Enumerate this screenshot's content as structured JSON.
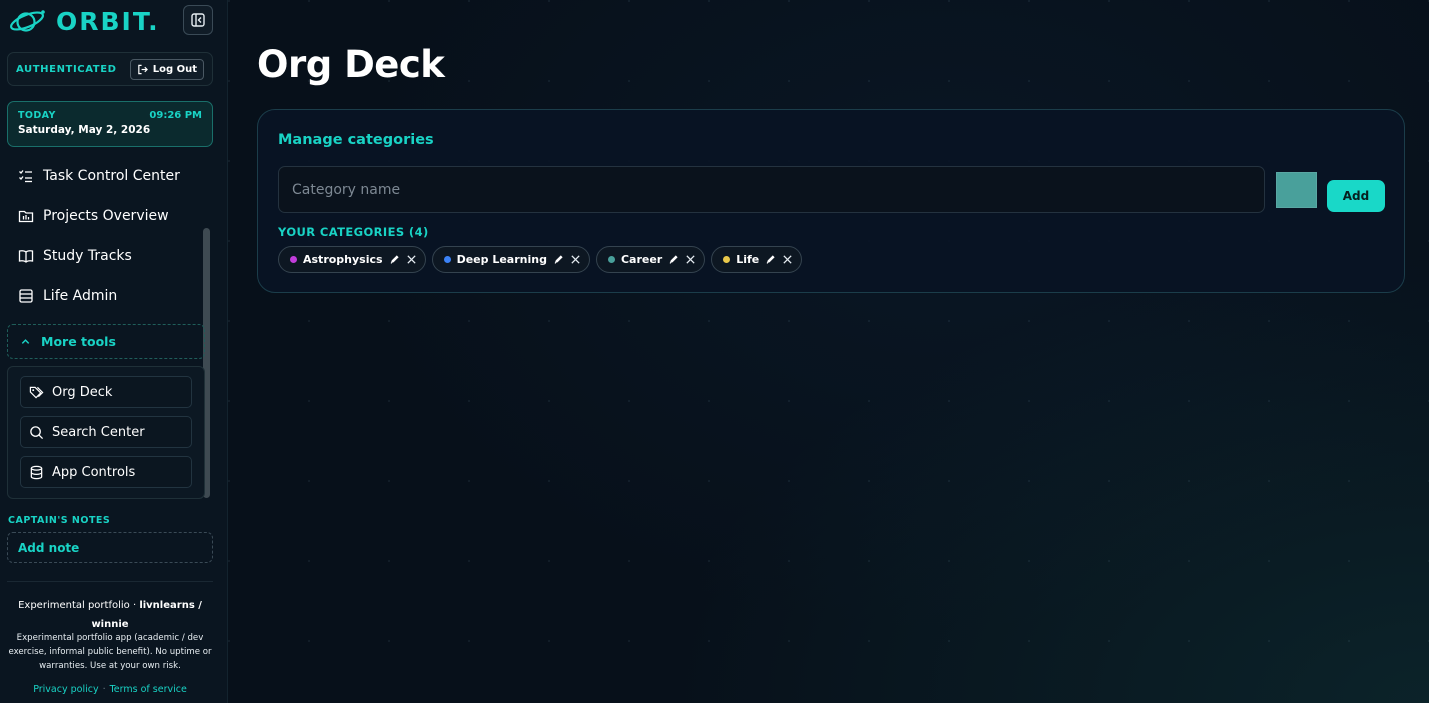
{
  "brand": {
    "name": "ORBIT."
  },
  "auth": {
    "status": "AUTHENTICATED",
    "logout_label": "Log Out"
  },
  "today": {
    "label": "TODAY",
    "time": "09:26 PM",
    "date": "Saturday, May 2, 2026"
  },
  "nav": [
    {
      "label": "Task Control Center",
      "icon": "checklist-icon"
    },
    {
      "label": "Projects Overview",
      "icon": "projects-icon"
    },
    {
      "label": "Study Tracks",
      "icon": "book-icon"
    },
    {
      "label": "Life Admin",
      "icon": "list-icon"
    }
  ],
  "more_tools": {
    "label": "More tools",
    "items": [
      {
        "label": "Org Deck",
        "icon": "tags-icon"
      },
      {
        "label": "Search Center",
        "icon": "search-icon"
      },
      {
        "label": "App Controls",
        "icon": "database-icon"
      }
    ]
  },
  "notes": {
    "label": "CAPTAIN'S NOTES",
    "add_label": "Add note"
  },
  "footer": {
    "title_prefix": "Experimental portfolio · ",
    "title_bold": "livnlearns / winnie",
    "description": "Experimental portfolio app (academic / dev exercise, informal public benefit). No uptime or warranties. Use at your own risk.",
    "privacy": "Privacy policy",
    "separator": "·",
    "terms": "Terms of service"
  },
  "page": {
    "title": "Org Deck"
  },
  "manage": {
    "title": "Manage categories",
    "input_placeholder": "Category name",
    "input_value": "",
    "swatch_color": "#49a09b",
    "add_label": "Add",
    "list_label": "YOUR CATEGORIES (4)"
  },
  "categories": [
    {
      "name": "Astrophysics",
      "color": "#c13ddb"
    },
    {
      "name": "Deep Learning",
      "color": "#3b82f6"
    },
    {
      "name": "Career",
      "color": "#49a09b"
    },
    {
      "name": "Life",
      "color": "#e9c84b"
    }
  ],
  "colors": {
    "accent": "#19d3c5",
    "background": "#07101a",
    "sidebar": "#0a1520"
  }
}
